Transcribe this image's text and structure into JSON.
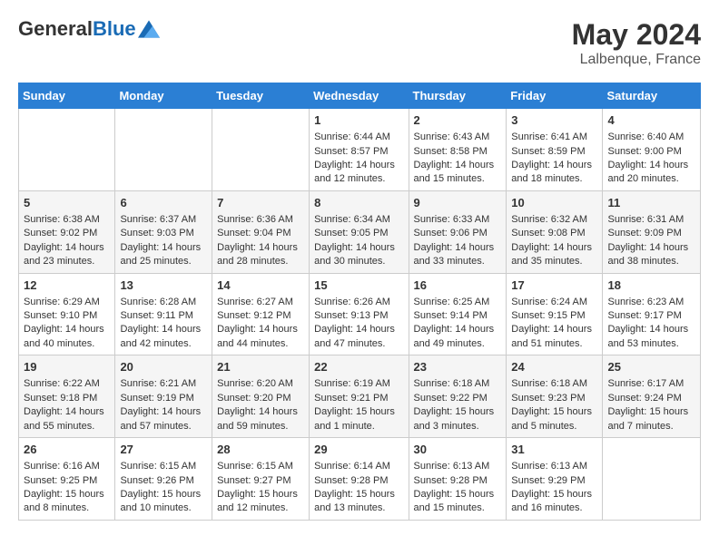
{
  "header": {
    "logo_general": "General",
    "logo_blue": "Blue",
    "month_year": "May 2024",
    "location": "Lalbenque, France"
  },
  "calendar": {
    "days_of_week": [
      "Sunday",
      "Monday",
      "Tuesday",
      "Wednesday",
      "Thursday",
      "Friday",
      "Saturday"
    ],
    "weeks": [
      [
        {
          "day": "",
          "info": ""
        },
        {
          "day": "",
          "info": ""
        },
        {
          "day": "",
          "info": ""
        },
        {
          "day": "1",
          "sunrise": "Sunrise: 6:44 AM",
          "sunset": "Sunset: 8:57 PM",
          "daylight": "Daylight: 14 hours and 12 minutes."
        },
        {
          "day": "2",
          "sunrise": "Sunrise: 6:43 AM",
          "sunset": "Sunset: 8:58 PM",
          "daylight": "Daylight: 14 hours and 15 minutes."
        },
        {
          "day": "3",
          "sunrise": "Sunrise: 6:41 AM",
          "sunset": "Sunset: 8:59 PM",
          "daylight": "Daylight: 14 hours and 18 minutes."
        },
        {
          "day": "4",
          "sunrise": "Sunrise: 6:40 AM",
          "sunset": "Sunset: 9:00 PM",
          "daylight": "Daylight: 14 hours and 20 minutes."
        }
      ],
      [
        {
          "day": "5",
          "sunrise": "Sunrise: 6:38 AM",
          "sunset": "Sunset: 9:02 PM",
          "daylight": "Daylight: 14 hours and 23 minutes."
        },
        {
          "day": "6",
          "sunrise": "Sunrise: 6:37 AM",
          "sunset": "Sunset: 9:03 PM",
          "daylight": "Daylight: 14 hours and 25 minutes."
        },
        {
          "day": "7",
          "sunrise": "Sunrise: 6:36 AM",
          "sunset": "Sunset: 9:04 PM",
          "daylight": "Daylight: 14 hours and 28 minutes."
        },
        {
          "day": "8",
          "sunrise": "Sunrise: 6:34 AM",
          "sunset": "Sunset: 9:05 PM",
          "daylight": "Daylight: 14 hours and 30 minutes."
        },
        {
          "day": "9",
          "sunrise": "Sunrise: 6:33 AM",
          "sunset": "Sunset: 9:06 PM",
          "daylight": "Daylight: 14 hours and 33 minutes."
        },
        {
          "day": "10",
          "sunrise": "Sunrise: 6:32 AM",
          "sunset": "Sunset: 9:08 PM",
          "daylight": "Daylight: 14 hours and 35 minutes."
        },
        {
          "day": "11",
          "sunrise": "Sunrise: 6:31 AM",
          "sunset": "Sunset: 9:09 PM",
          "daylight": "Daylight: 14 hours and 38 minutes."
        }
      ],
      [
        {
          "day": "12",
          "sunrise": "Sunrise: 6:29 AM",
          "sunset": "Sunset: 9:10 PM",
          "daylight": "Daylight: 14 hours and 40 minutes."
        },
        {
          "day": "13",
          "sunrise": "Sunrise: 6:28 AM",
          "sunset": "Sunset: 9:11 PM",
          "daylight": "Daylight: 14 hours and 42 minutes."
        },
        {
          "day": "14",
          "sunrise": "Sunrise: 6:27 AM",
          "sunset": "Sunset: 9:12 PM",
          "daylight": "Daylight: 14 hours and 44 minutes."
        },
        {
          "day": "15",
          "sunrise": "Sunrise: 6:26 AM",
          "sunset": "Sunset: 9:13 PM",
          "daylight": "Daylight: 14 hours and 47 minutes."
        },
        {
          "day": "16",
          "sunrise": "Sunrise: 6:25 AM",
          "sunset": "Sunset: 9:14 PM",
          "daylight": "Daylight: 14 hours and 49 minutes."
        },
        {
          "day": "17",
          "sunrise": "Sunrise: 6:24 AM",
          "sunset": "Sunset: 9:15 PM",
          "daylight": "Daylight: 14 hours and 51 minutes."
        },
        {
          "day": "18",
          "sunrise": "Sunrise: 6:23 AM",
          "sunset": "Sunset: 9:17 PM",
          "daylight": "Daylight: 14 hours and 53 minutes."
        }
      ],
      [
        {
          "day": "19",
          "sunrise": "Sunrise: 6:22 AM",
          "sunset": "Sunset: 9:18 PM",
          "daylight": "Daylight: 14 hours and 55 minutes."
        },
        {
          "day": "20",
          "sunrise": "Sunrise: 6:21 AM",
          "sunset": "Sunset: 9:19 PM",
          "daylight": "Daylight: 14 hours and 57 minutes."
        },
        {
          "day": "21",
          "sunrise": "Sunrise: 6:20 AM",
          "sunset": "Sunset: 9:20 PM",
          "daylight": "Daylight: 14 hours and 59 minutes."
        },
        {
          "day": "22",
          "sunrise": "Sunrise: 6:19 AM",
          "sunset": "Sunset: 9:21 PM",
          "daylight": "Daylight: 15 hours and 1 minute."
        },
        {
          "day": "23",
          "sunrise": "Sunrise: 6:18 AM",
          "sunset": "Sunset: 9:22 PM",
          "daylight": "Daylight: 15 hours and 3 minutes."
        },
        {
          "day": "24",
          "sunrise": "Sunrise: 6:18 AM",
          "sunset": "Sunset: 9:23 PM",
          "daylight": "Daylight: 15 hours and 5 minutes."
        },
        {
          "day": "25",
          "sunrise": "Sunrise: 6:17 AM",
          "sunset": "Sunset: 9:24 PM",
          "daylight": "Daylight: 15 hours and 7 minutes."
        }
      ],
      [
        {
          "day": "26",
          "sunrise": "Sunrise: 6:16 AM",
          "sunset": "Sunset: 9:25 PM",
          "daylight": "Daylight: 15 hours and 8 minutes."
        },
        {
          "day": "27",
          "sunrise": "Sunrise: 6:15 AM",
          "sunset": "Sunset: 9:26 PM",
          "daylight": "Daylight: 15 hours and 10 minutes."
        },
        {
          "day": "28",
          "sunrise": "Sunrise: 6:15 AM",
          "sunset": "Sunset: 9:27 PM",
          "daylight": "Daylight: 15 hours and 12 minutes."
        },
        {
          "day": "29",
          "sunrise": "Sunrise: 6:14 AM",
          "sunset": "Sunset: 9:28 PM",
          "daylight": "Daylight: 15 hours and 13 minutes."
        },
        {
          "day": "30",
          "sunrise": "Sunrise: 6:13 AM",
          "sunset": "Sunset: 9:28 PM",
          "daylight": "Daylight: 15 hours and 15 minutes."
        },
        {
          "day": "31",
          "sunrise": "Sunrise: 6:13 AM",
          "sunset": "Sunset: 9:29 PM",
          "daylight": "Daylight: 15 hours and 16 minutes."
        },
        {
          "day": "",
          "info": ""
        }
      ]
    ]
  }
}
